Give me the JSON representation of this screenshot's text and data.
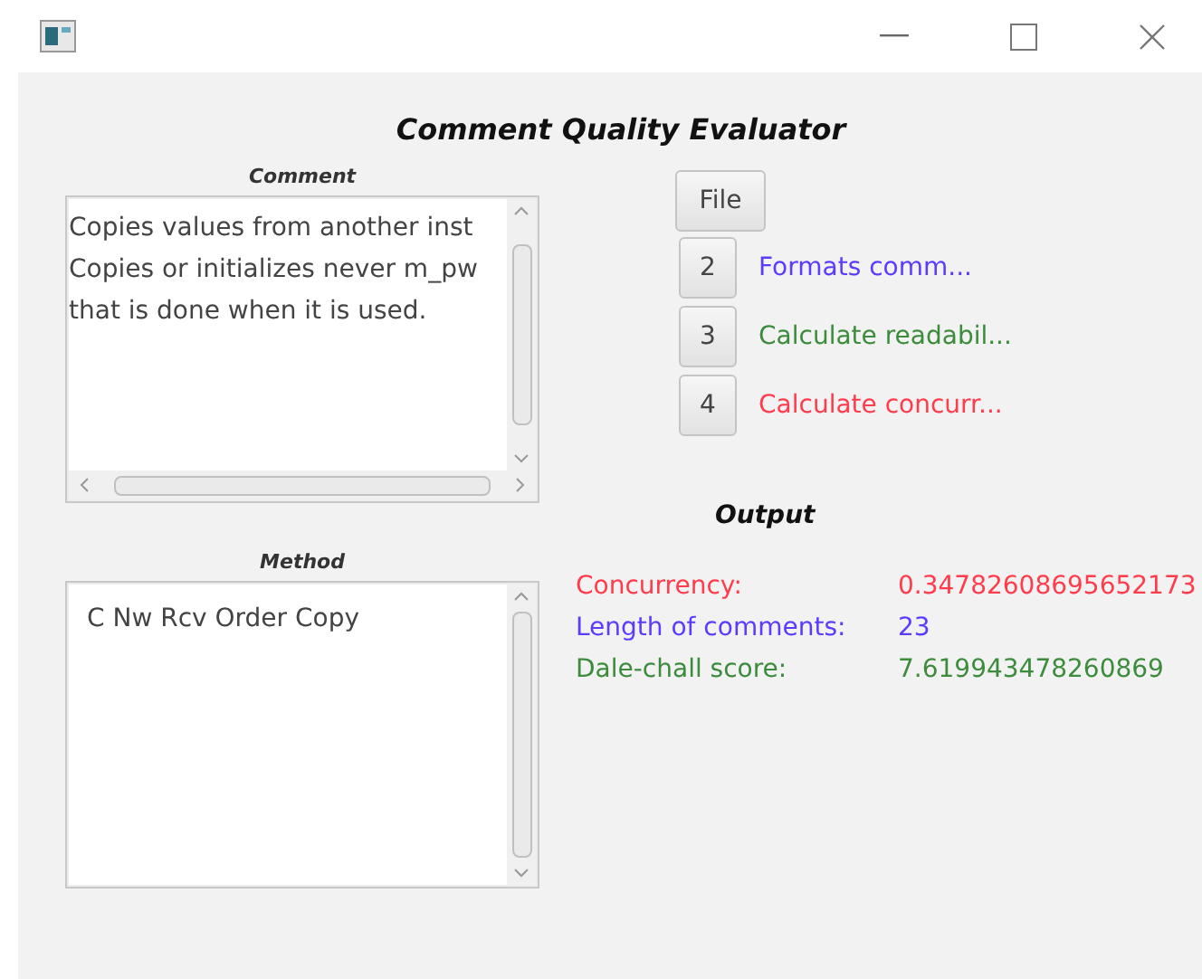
{
  "window": {
    "title": "Comment Quality Evaluator"
  },
  "comment": {
    "label": "Comment",
    "lines": [
      "Copies values from another inst",
      "Copies or initializes never m_pw",
      "that is done when it is used."
    ]
  },
  "method": {
    "label": "Method",
    "lines": [
      "C Nw Rcv Order Copy"
    ]
  },
  "file_button": {
    "label": "File"
  },
  "actions": [
    {
      "button": "2",
      "label": "Formats comm...",
      "color": "#5a3cff"
    },
    {
      "button": "3",
      "label": "Calculate readabil...",
      "color": "#3c8c3c"
    },
    {
      "button": "4",
      "label": "Calculate concurr...",
      "color": "#ff3c4c"
    }
  ],
  "output": {
    "label": "Output",
    "rows": [
      {
        "label": "Concurrency:",
        "value": "0.34782608695652173",
        "color": "#ff3c4c"
      },
      {
        "label": "Length of comments:",
        "value": "23",
        "color": "#5a3cff"
      },
      {
        "label": "Dale-chall score:",
        "value": "7.619943478260869",
        "color": "#3c8c3c"
      }
    ]
  }
}
